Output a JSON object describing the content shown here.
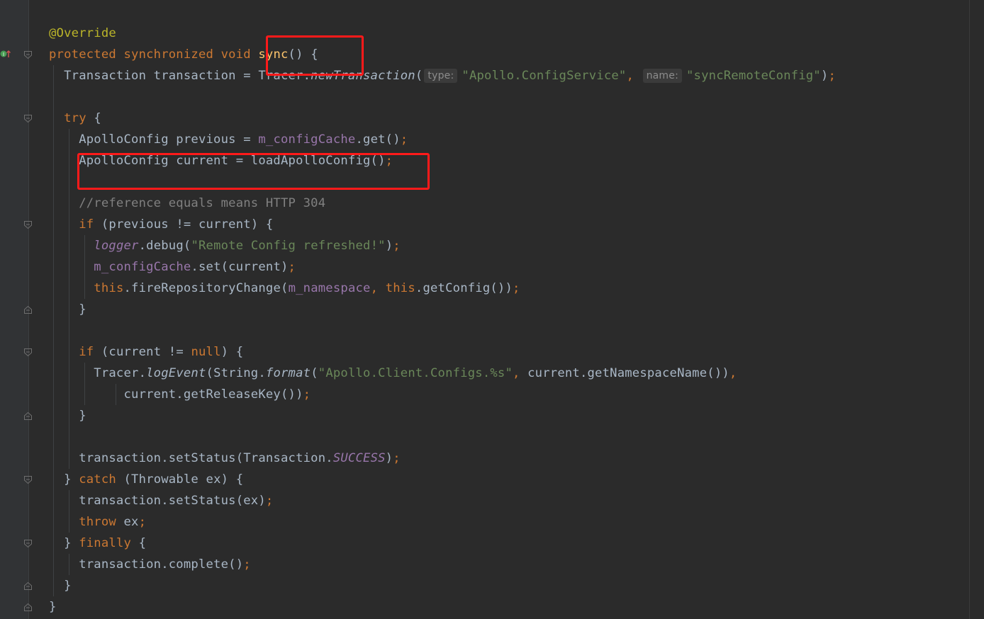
{
  "code_lines": [
    [
      {
        "t": "@Override",
        "c": "an"
      }
    ],
    [
      {
        "t": "protected synchronized void ",
        "c": "kw"
      },
      {
        "t": "sync",
        "c": "fn"
      },
      {
        "t": "() {",
        "c": ""
      }
    ],
    [
      {
        "t": "  Transaction transaction = Tracer.",
        "c": ""
      },
      {
        "t": "newTransaction",
        "c": "it"
      },
      {
        "t": "(",
        "c": ""
      },
      {
        "hint": "type:"
      },
      {
        "t": "\"Apollo.ConfigService\"",
        "c": "st"
      },
      {
        "t": ", ",
        "c": "kw"
      },
      {
        "hint": "name:"
      },
      {
        "t": "\"syncRemoteConfig\"",
        "c": "st"
      },
      {
        "t": ")",
        "c": ""
      },
      {
        "t": ";",
        "c": "kw"
      }
    ],
    [],
    [
      {
        "t": "  ",
        "c": ""
      },
      {
        "t": "try",
        "c": "kw"
      },
      {
        "t": " {",
        "c": ""
      }
    ],
    [
      {
        "t": "    ApolloConfig previous = ",
        "c": ""
      },
      {
        "t": "m_configCache",
        "c": "fd"
      },
      {
        "t": ".get()",
        "c": ""
      },
      {
        "t": ";",
        "c": "kw"
      }
    ],
    [
      {
        "t": "    ApolloConfig current = loadApolloConfig()",
        "c": ""
      },
      {
        "t": ";",
        "c": "kw"
      }
    ],
    [],
    [
      {
        "t": "    //reference equals means HTTP 304",
        "c": "cm"
      }
    ],
    [
      {
        "t": "    ",
        "c": ""
      },
      {
        "t": "if",
        "c": "kw"
      },
      {
        "t": " (previous != current) {",
        "c": ""
      }
    ],
    [
      {
        "t": "      ",
        "c": ""
      },
      {
        "t": "logger",
        "c": "fd it"
      },
      {
        "t": ".debug(",
        "c": ""
      },
      {
        "t": "\"Remote Config refreshed!\"",
        "c": "st"
      },
      {
        "t": ")",
        "c": ""
      },
      {
        "t": ";",
        "c": "kw"
      }
    ],
    [
      {
        "t": "      ",
        "c": ""
      },
      {
        "t": "m_configCache",
        "c": "fd"
      },
      {
        "t": ".set(current)",
        "c": ""
      },
      {
        "t": ";",
        "c": "kw"
      }
    ],
    [
      {
        "t": "      ",
        "c": ""
      },
      {
        "t": "this",
        "c": "kw"
      },
      {
        "t": ".fireRepositoryChange(",
        "c": ""
      },
      {
        "t": "m_namespace",
        "c": "fd"
      },
      {
        "t": ", ",
        "c": "kw"
      },
      {
        "t": "this",
        "c": "kw"
      },
      {
        "t": ".getConfig())",
        "c": ""
      },
      {
        "t": ";",
        "c": "kw"
      }
    ],
    [
      {
        "t": "    }",
        "c": ""
      }
    ],
    [],
    [
      {
        "t": "    ",
        "c": ""
      },
      {
        "t": "if",
        "c": "kw"
      },
      {
        "t": " (current != ",
        "c": ""
      },
      {
        "t": "null",
        "c": "kw"
      },
      {
        "t": ") {",
        "c": ""
      }
    ],
    [
      {
        "t": "      Tracer.",
        "c": ""
      },
      {
        "t": "logEvent",
        "c": "it"
      },
      {
        "t": "(String.",
        "c": ""
      },
      {
        "t": "format",
        "c": "it"
      },
      {
        "t": "(",
        "c": ""
      },
      {
        "t": "\"Apollo.Client.Configs.%s\"",
        "c": "st"
      },
      {
        "t": ", ",
        "c": "kw"
      },
      {
        "t": "current.getNamespaceName())",
        "c": ""
      },
      {
        "t": ",",
        "c": "kw"
      }
    ],
    [
      {
        "t": "          current.getReleaseKey())",
        "c": ""
      },
      {
        "t": ";",
        "c": "kw"
      }
    ],
    [
      {
        "t": "    }",
        "c": ""
      }
    ],
    [],
    [
      {
        "t": "    transaction.setStatus(Transaction.",
        "c": ""
      },
      {
        "t": "SUCCESS",
        "c": "fd it"
      },
      {
        "t": ")",
        "c": ""
      },
      {
        "t": ";",
        "c": "kw"
      }
    ],
    [
      {
        "t": "  } ",
        "c": ""
      },
      {
        "t": "catch",
        "c": "kw"
      },
      {
        "t": " (Throwable ex) {",
        "c": ""
      }
    ],
    [
      {
        "t": "    transaction.setStatus(ex)",
        "c": ""
      },
      {
        "t": ";",
        "c": "kw"
      }
    ],
    [
      {
        "t": "    ",
        "c": ""
      },
      {
        "t": "throw",
        "c": "kw"
      },
      {
        "t": " ex",
        "c": ""
      },
      {
        "t": ";",
        "c": "kw"
      }
    ],
    [
      {
        "t": "  } ",
        "c": ""
      },
      {
        "t": "finally",
        "c": "kw"
      },
      {
        "t": " {",
        "c": ""
      }
    ],
    [
      {
        "t": "    transaction.complete()",
        "c": ""
      },
      {
        "t": ";",
        "c": "kw"
      }
    ],
    [
      {
        "t": "  }",
        "c": ""
      }
    ],
    [
      {
        "t": "}",
        "c": ""
      }
    ]
  ],
  "fold_markers": [
    {
      "line": 1,
      "kind": "open"
    },
    {
      "line": 4,
      "kind": "open"
    },
    {
      "line": 9,
      "kind": "open"
    },
    {
      "line": 13,
      "kind": "close"
    },
    {
      "line": 15,
      "kind": "open"
    },
    {
      "line": 18,
      "kind": "close"
    },
    {
      "line": 21,
      "kind": "open"
    },
    {
      "line": 24,
      "kind": "open"
    },
    {
      "line": 26,
      "kind": "close"
    },
    {
      "line": 27,
      "kind": "close"
    }
  ],
  "gutter_icon": "override-method-icon",
  "colors": {
    "background": "#2b2b2b",
    "keyword": "#cc7832",
    "annotation": "#bbb529",
    "field": "#9876aa",
    "string": "#6a8759",
    "comment": "#808080",
    "method_decl": "#ffc66d",
    "highlight": "#ff1a1a"
  }
}
